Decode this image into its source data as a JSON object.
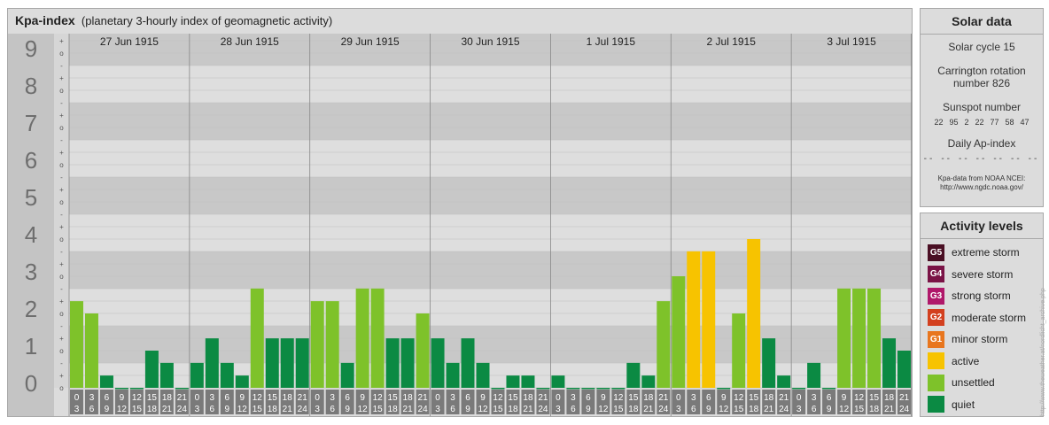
{
  "header": {
    "title": "Kpa-index",
    "subtitle": "(planetary 3-hourly index of geomagnetic activity)"
  },
  "chart_data": {
    "type": "bar",
    "ylim": [
      0,
      9
    ],
    "y_ticks": [
      "0",
      "1",
      "2",
      "3",
      "4",
      "5",
      "6",
      "7",
      "8",
      "9"
    ],
    "sub_ticks": [
      "o",
      "-",
      "+"
    ],
    "days": [
      "27 Jun 1915",
      "28 Jun 1915",
      "29 Jun 1915",
      "30 Jun 1915",
      "1 Jul 1915",
      "2 Jul 1915",
      "3 Jul 1915"
    ],
    "interval_labels": [
      [
        "0",
        "3"
      ],
      [
        "3",
        "6"
      ],
      [
        "6",
        "9"
      ],
      [
        "9",
        "12"
      ],
      [
        "12",
        "15"
      ],
      [
        "15",
        "18"
      ],
      [
        "18",
        "21"
      ],
      [
        "21",
        "24"
      ]
    ],
    "values": [
      [
        2.33,
        2.0,
        0.33,
        0.0,
        0.0,
        1.0,
        0.67,
        0.0
      ],
      [
        0.67,
        1.33,
        0.67,
        0.33,
        2.67,
        1.33,
        1.33,
        1.33
      ],
      [
        2.33,
        2.33,
        0.67,
        2.67,
        2.67,
        1.33,
        1.33,
        2.0
      ],
      [
        1.33,
        0.67,
        1.33,
        0.67,
        0.0,
        0.33,
        0.33,
        0.0
      ],
      [
        0.33,
        0.0,
        0.0,
        0.0,
        0.0,
        0.67,
        0.33,
        2.33
      ],
      [
        3.0,
        3.67,
        3.67,
        0.0,
        2.0,
        4.0,
        1.33,
        0.33
      ],
      [
        0.0,
        0.67,
        0.0,
        2.67,
        2.67,
        2.67,
        1.33,
        1.0
      ]
    ],
    "colors": {
      "quiet": "#0b8a43",
      "unsettled": "#7ec22a",
      "active": "#f7c300",
      "band_dark": "#c8c8c8",
      "band_light": "#dedede",
      "axis_num_bg": "#c4c4c4",
      "axis_num_text": "#6e6e6e"
    },
    "grid": true
  },
  "solar": {
    "title": "Solar data",
    "cycle": "Solar cycle 15",
    "carrington_line1": "Carrington rotation",
    "carrington_line2": "number 826",
    "sunspot_title": "Sunspot number",
    "sunspots": [
      "22",
      "95",
      "2",
      "22",
      "77",
      "58",
      "47"
    ],
    "ap_title": "Daily Ap-index",
    "ap_values": [
      "--",
      "--",
      "--",
      "--",
      "--",
      "--",
      "--"
    ],
    "source_line1": "Kpa-data from NOAA NCEI:",
    "source_line2": "http://www.ngdc.noaa.gov/"
  },
  "activity": {
    "title": "Activity levels",
    "levels": [
      {
        "badge": "G5",
        "label": "extreme storm",
        "color": "#4a0f24"
      },
      {
        "badge": "G4",
        "label": "severe storm",
        "color": "#7a1346"
      },
      {
        "badge": "G3",
        "label": "strong storm",
        "color": "#b0186a"
      },
      {
        "badge": "G2",
        "label": "moderate storm",
        "color": "#d3401f"
      },
      {
        "badge": "G1",
        "label": "minor storm",
        "color": "#e8761e"
      },
      {
        "badge": "",
        "label": "active",
        "color": "#f7c300"
      },
      {
        "badge": "",
        "label": "unsettled",
        "color": "#7ec22a"
      },
      {
        "badge": "",
        "label": "quiet",
        "color": "#0b8a43"
      }
    ]
  },
  "credit": "http://www.theweather.at/nordlicht_archive.php"
}
